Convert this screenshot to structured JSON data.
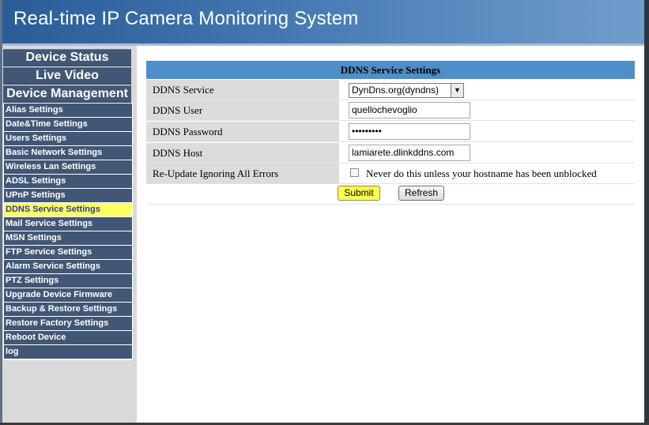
{
  "header": {
    "title": "Real-time IP Camera Monitoring System"
  },
  "top_nav": [
    {
      "label": "Device Status"
    },
    {
      "label": "Live Video"
    },
    {
      "label": "Device Management"
    }
  ],
  "menu": [
    {
      "label": "Alias Settings"
    },
    {
      "label": "Date&Time Settings"
    },
    {
      "label": "Users Settings"
    },
    {
      "label": "Basic Network Settings"
    },
    {
      "label": "Wireless Lan Settings"
    },
    {
      "label": "ADSL Settings"
    },
    {
      "label": "UPnP Settings"
    },
    {
      "label": "DDNS Service Settings"
    },
    {
      "label": "Mail Service Settings"
    },
    {
      "label": "MSN Settings"
    },
    {
      "label": "FTP Service Settings"
    },
    {
      "label": "Alarm Service Settings"
    },
    {
      "label": "PTZ Settings"
    },
    {
      "label": "Upgrade Device Firmware"
    },
    {
      "label": "Backup & Restore Settings"
    },
    {
      "label": "Restore Factory Settings"
    },
    {
      "label": "Reboot Device"
    },
    {
      "label": "log"
    }
  ],
  "active_menu_item": "DDNS Service Settings",
  "form": {
    "title": "DDNS Service Settings",
    "service_label": "DDNS Service",
    "service_value": "DynDns.org(dyndns)",
    "user_label": "DDNS User",
    "user_value": "quellochevoglio",
    "password_label": "DDNS Password",
    "password_value": "•••••••••",
    "host_label": "DDNS Host",
    "host_value": "lamiarete.dlinkddns.com",
    "reupdate_label": "Re-Update Ignoring All Errors",
    "reupdate_checked": false,
    "reupdate_note": "Never do this unless your hostname has been unblocked",
    "submit_label": "Submit",
    "refresh_label": "Refresh"
  },
  "colors": {
    "header_start": "#2a5c96",
    "header_end": "#6f9dcb",
    "nav_bg": "#425775",
    "active_highlight": "#ffff66",
    "panel_header": "#4f8ec8"
  }
}
